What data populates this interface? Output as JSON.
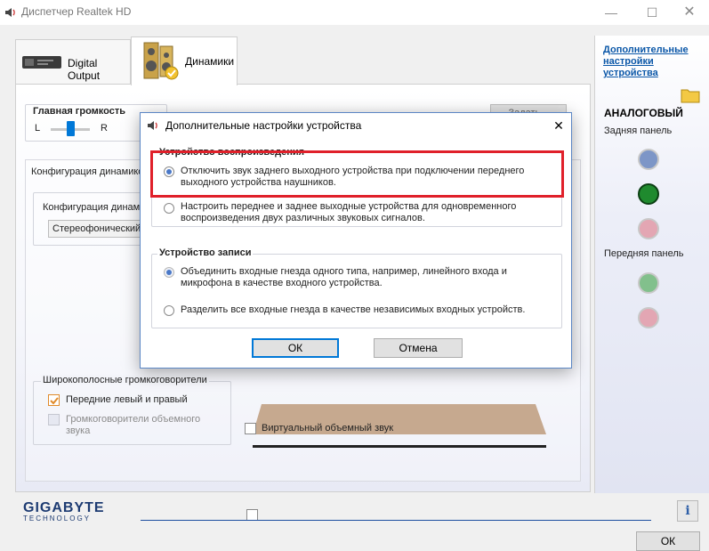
{
  "window": {
    "title": "Диспетчер Realtek HD"
  },
  "tabs": [
    {
      "label": "Digital Output"
    },
    {
      "label": "Динамики"
    }
  ],
  "main": {
    "volume_title": "Главная громкость",
    "volume_left": "L",
    "volume_right": "R",
    "set_default_label": "Задать...",
    "config_title": "Конфигурация динамиков",
    "config_select_label": "Конфигурация динамиков",
    "config_select_value": "Стереофонический",
    "wideband_title": "Широкополосные громкоговорители",
    "front_lr_label": "Передние левый и правый",
    "surround_label": "Громкоговорители объемного звука",
    "virtual_surround_label": "Виртуальный объемный звук"
  },
  "right_panel": {
    "link": "Дополнительные настройки устройства",
    "analog_title": "АНАЛОГОВЫЙ",
    "rear_panel": "Задняя панель",
    "front_panel": "Передняя панель",
    "jack_colors": {
      "rear_blue": "#7d96c7",
      "rear_green": "#1f8a2e",
      "rear_pink": "#e3a6b3",
      "front_green": "#82c08c",
      "front_pink": "#e3a6b3"
    }
  },
  "dialog": {
    "title": "Дополнительные настройки устройства",
    "close": "✕",
    "playback_group": "Устройство воспроизведения",
    "playback_opt1": "Отключить звук заднего выходного устройства при подключении переднего выходного устройства наушников.",
    "playback_opt2": "Настроить переднее и заднее выходные устройства для одновременного воспроизведения двух различных звуковых сигналов.",
    "record_group": "Устройство записи",
    "record_opt1": "Объединить входные гнезда одного типа, например, линейного входа и микрофона в качестве входного устройства.",
    "record_opt2": "Разделить все входные гнезда в качестве независимых входных устройств.",
    "ok": "ОК",
    "cancel": "Отмена"
  },
  "footer": {
    "brand": "GIGABYTE",
    "brand_sub": "TECHNOLOGY",
    "ok": "ОК",
    "info": "i"
  },
  "colors": {
    "highlight": "#e0202a",
    "accent": "#0078d7",
    "link": "#0b57a8"
  }
}
